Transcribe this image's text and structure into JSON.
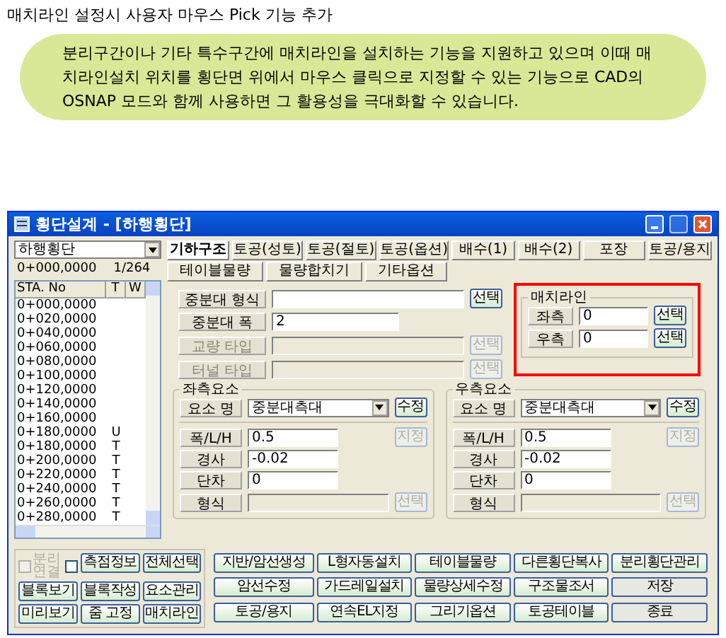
{
  "document_title": "매치라인 설정시 사용자 마우스 Pick 기능 추가",
  "callout": "분리구간이나 기타 특수구간에 매치라인을 설치하는 기능을 지원하고 있으며 이때 매치라인설치 위치를 횡단면 위에서 마우스 클릭으로 지정할 수 있는 기능으로 CAD의 OSNAP 모드와 함께 사용하면 그 활용성을 극대화할 수 있습니다.",
  "window": {
    "title": "횡단설계 - [하행횡단]"
  },
  "left_panel": {
    "section_combo": "하행횡단",
    "station": "0+000,0000",
    "count": "1/264",
    "columns": [
      "STA. No",
      "T",
      "W"
    ],
    "rows": [
      {
        "sta": "0+000,0000"
      },
      {
        "sta": "0+020,0000"
      },
      {
        "sta": "0+040,0000"
      },
      {
        "sta": "0+060,0000"
      },
      {
        "sta": "0+080,0000"
      },
      {
        "sta": "0+100,0000"
      },
      {
        "sta": "0+120,0000"
      },
      {
        "sta": "0+140,0000"
      },
      {
        "sta": "0+160,0000"
      },
      {
        "sta": "0+180,0000",
        "t": "U"
      },
      {
        "sta": "0+180,0000",
        "t": "T"
      },
      {
        "sta": "0+200,0000",
        "t": "T"
      },
      {
        "sta": "0+220,0000",
        "t": "T"
      },
      {
        "sta": "0+240,0000",
        "t": "T"
      },
      {
        "sta": "0+260,0000",
        "t": "T"
      },
      {
        "sta": "0+280,0000",
        "t": "T"
      }
    ]
  },
  "tabs": [
    [
      {
        "label": "기하구조",
        "selected": true
      },
      {
        "label": "토공(성토)",
        "selected": false
      },
      {
        "label": "토공(절토)",
        "selected": false
      },
      {
        "label": "토공(옵션)",
        "selected": false
      },
      {
        "label": "배수(1)",
        "selected": false
      },
      {
        "label": "배수(2)",
        "selected": false
      },
      {
        "label": "포장",
        "selected": false
      },
      {
        "label": "토공/용지",
        "selected": false
      }
    ],
    [
      {
        "label": "테이블물량",
        "selected": false
      },
      {
        "label": "물량합치기",
        "selected": false
      },
      {
        "label": "기타옵션",
        "selected": false
      }
    ]
  ],
  "median": [
    {
      "label": "중분대 형식",
      "button": "선택",
      "disabled": false
    },
    {
      "label": "중분대 폭",
      "value": "2",
      "disabled": false
    },
    {
      "label": "교량 타입",
      "button": "선택",
      "disabled": true
    },
    {
      "label": "터널 타입",
      "button": "선택",
      "disabled": true
    }
  ],
  "matchline": {
    "title": "매치라인",
    "rows": [
      {
        "label": "좌측",
        "value": "0",
        "button": "선택"
      },
      {
        "label": "우측",
        "value": "0",
        "button": "선택"
      }
    ]
  },
  "elements": [
    {
      "title": "좌측요소",
      "name_label": "요소 명",
      "name_value": "중분대측대",
      "edit_button": "수정",
      "set_button": "지정",
      "select_button": "선택",
      "fields": [
        {
          "label": "폭/L/H",
          "value": "0.5"
        },
        {
          "label": "경사",
          "value": "-0.02"
        },
        {
          "label": "단차",
          "value": "0"
        },
        {
          "label": "형식",
          "disabled": true
        }
      ]
    },
    {
      "title": "우측요소",
      "name_label": "요소 명",
      "name_value": "중분대측대",
      "edit_button": "수정",
      "set_button": "지정",
      "select_button": "선택",
      "fields": [
        {
          "label": "폭/L/H",
          "value": "0.5"
        },
        {
          "label": "경사",
          "value": "-0.02"
        },
        {
          "label": "단차",
          "value": "0"
        },
        {
          "label": "형식",
          "disabled": true
        }
      ]
    }
  ],
  "checkboxes": [
    {
      "label": "분리\n연결",
      "checked": false,
      "disabled": true
    },
    {
      "checked": false,
      "disabled": false
    }
  ],
  "group_buttons": [
    [
      "측점정보",
      "전체선택"
    ],
    [
      "블록보기",
      "블록작성",
      "요소관리"
    ],
    [
      "미리보기",
      "줌 고정",
      "매치라인"
    ]
  ],
  "buttons": [
    [
      "지반/암선생성",
      "L형자동설치",
      "테이블물량",
      "다른횡단복사",
      "분리횡단관리"
    ],
    [
      "암선수정",
      "가드레일설치",
      "물량상세수정",
      "구조물조서",
      "저장"
    ],
    [
      "토공/용지",
      "연속EL지정",
      "그리기옵션",
      "토공테이블",
      "종료"
    ]
  ]
}
